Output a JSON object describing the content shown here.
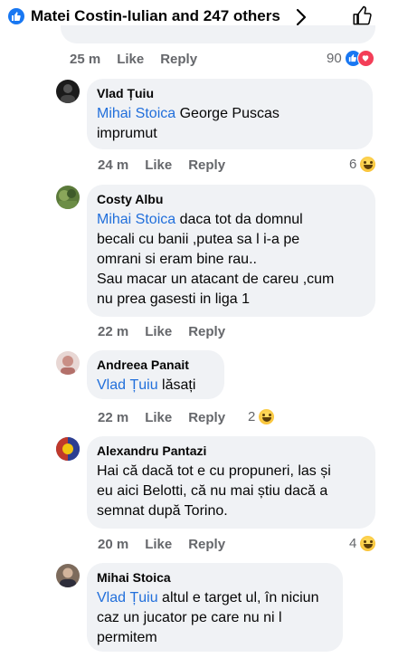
{
  "header": {
    "title": "Matei Costin-Iulian and 247 others"
  },
  "top_comment": {
    "time": "25 m",
    "like": "Like",
    "reply": "Reply",
    "reaction_count": "90"
  },
  "comments": [
    {
      "author": "Vlad Țuiu",
      "mention": "Mihai Stoica",
      "line1_rest": " George Puscas",
      "line2": "imprumut",
      "time": "24 m",
      "like": "Like",
      "reply": "Reply",
      "reaction_count": "6"
    },
    {
      "author": "Costy Albu",
      "mention": "Mihai Stoica",
      "line1_rest": " daca tot da domnul",
      "line2": "becali cu banii ,putea sa l i-a pe",
      "line3": "omrani si eram bine rau..",
      "line4": " Sau macar un atacant de careu ,cum",
      "line5": "nu prea gasesti in liga 1",
      "time": "22 m",
      "like": "Like",
      "reply": "Reply"
    },
    {
      "author": "Andreea Panait",
      "mention": "Vlad Țuiu",
      "line1_rest": " lăsați",
      "time": "22 m",
      "like": "Like",
      "reply": "Reply",
      "reaction_count": "2"
    },
    {
      "author": "Alexandru Pantazi",
      "line1": "Hai că dacă tot e cu propuneri, las și",
      "line2": "eu aici Belotti, că nu mai știu dacă a",
      "line3": "semnat după Torino.",
      "time": "20 m",
      "like": "Like",
      "reply": "Reply",
      "reaction_count": "4"
    },
    {
      "author": "Mihai Stoica",
      "mention": "Vlad Țuiu",
      "line1_rest": " altul e target ul, în niciun",
      "line2": "caz un jucator pe care nu ni l",
      "line3": "permitem"
    }
  ]
}
